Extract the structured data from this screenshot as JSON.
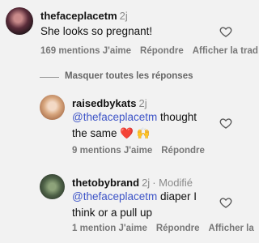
{
  "comments": [
    {
      "username": "thefaceplacetm",
      "time": "2j",
      "text": "She looks so pregnant!",
      "likes": "169 mentions J'aime",
      "reply": "Répondre",
      "translate": "Afficher la trad"
    }
  ],
  "hide_replies": "Masquer toutes les réponses",
  "replies": [
    {
      "username": "raisedbykats",
      "time": "2j",
      "mention": "@thefaceplacetm",
      "text_after_mention": " thought",
      "text_line2": "the same ",
      "emojis": "❤️ 🙌",
      "likes": "9 mentions J'aime",
      "reply": "Répondre"
    },
    {
      "username": "thetobybrand",
      "time": "2j",
      "modified": "· Modifié",
      "mention": "@thefaceplacetm",
      "text_after_mention": " diaper I",
      "text_line2": "think or a pull up",
      "likes": "1 mention J'aime",
      "reply": "Répondre",
      "translate": "Afficher la"
    }
  ],
  "icons": {
    "like": "heart-outline-icon"
  }
}
